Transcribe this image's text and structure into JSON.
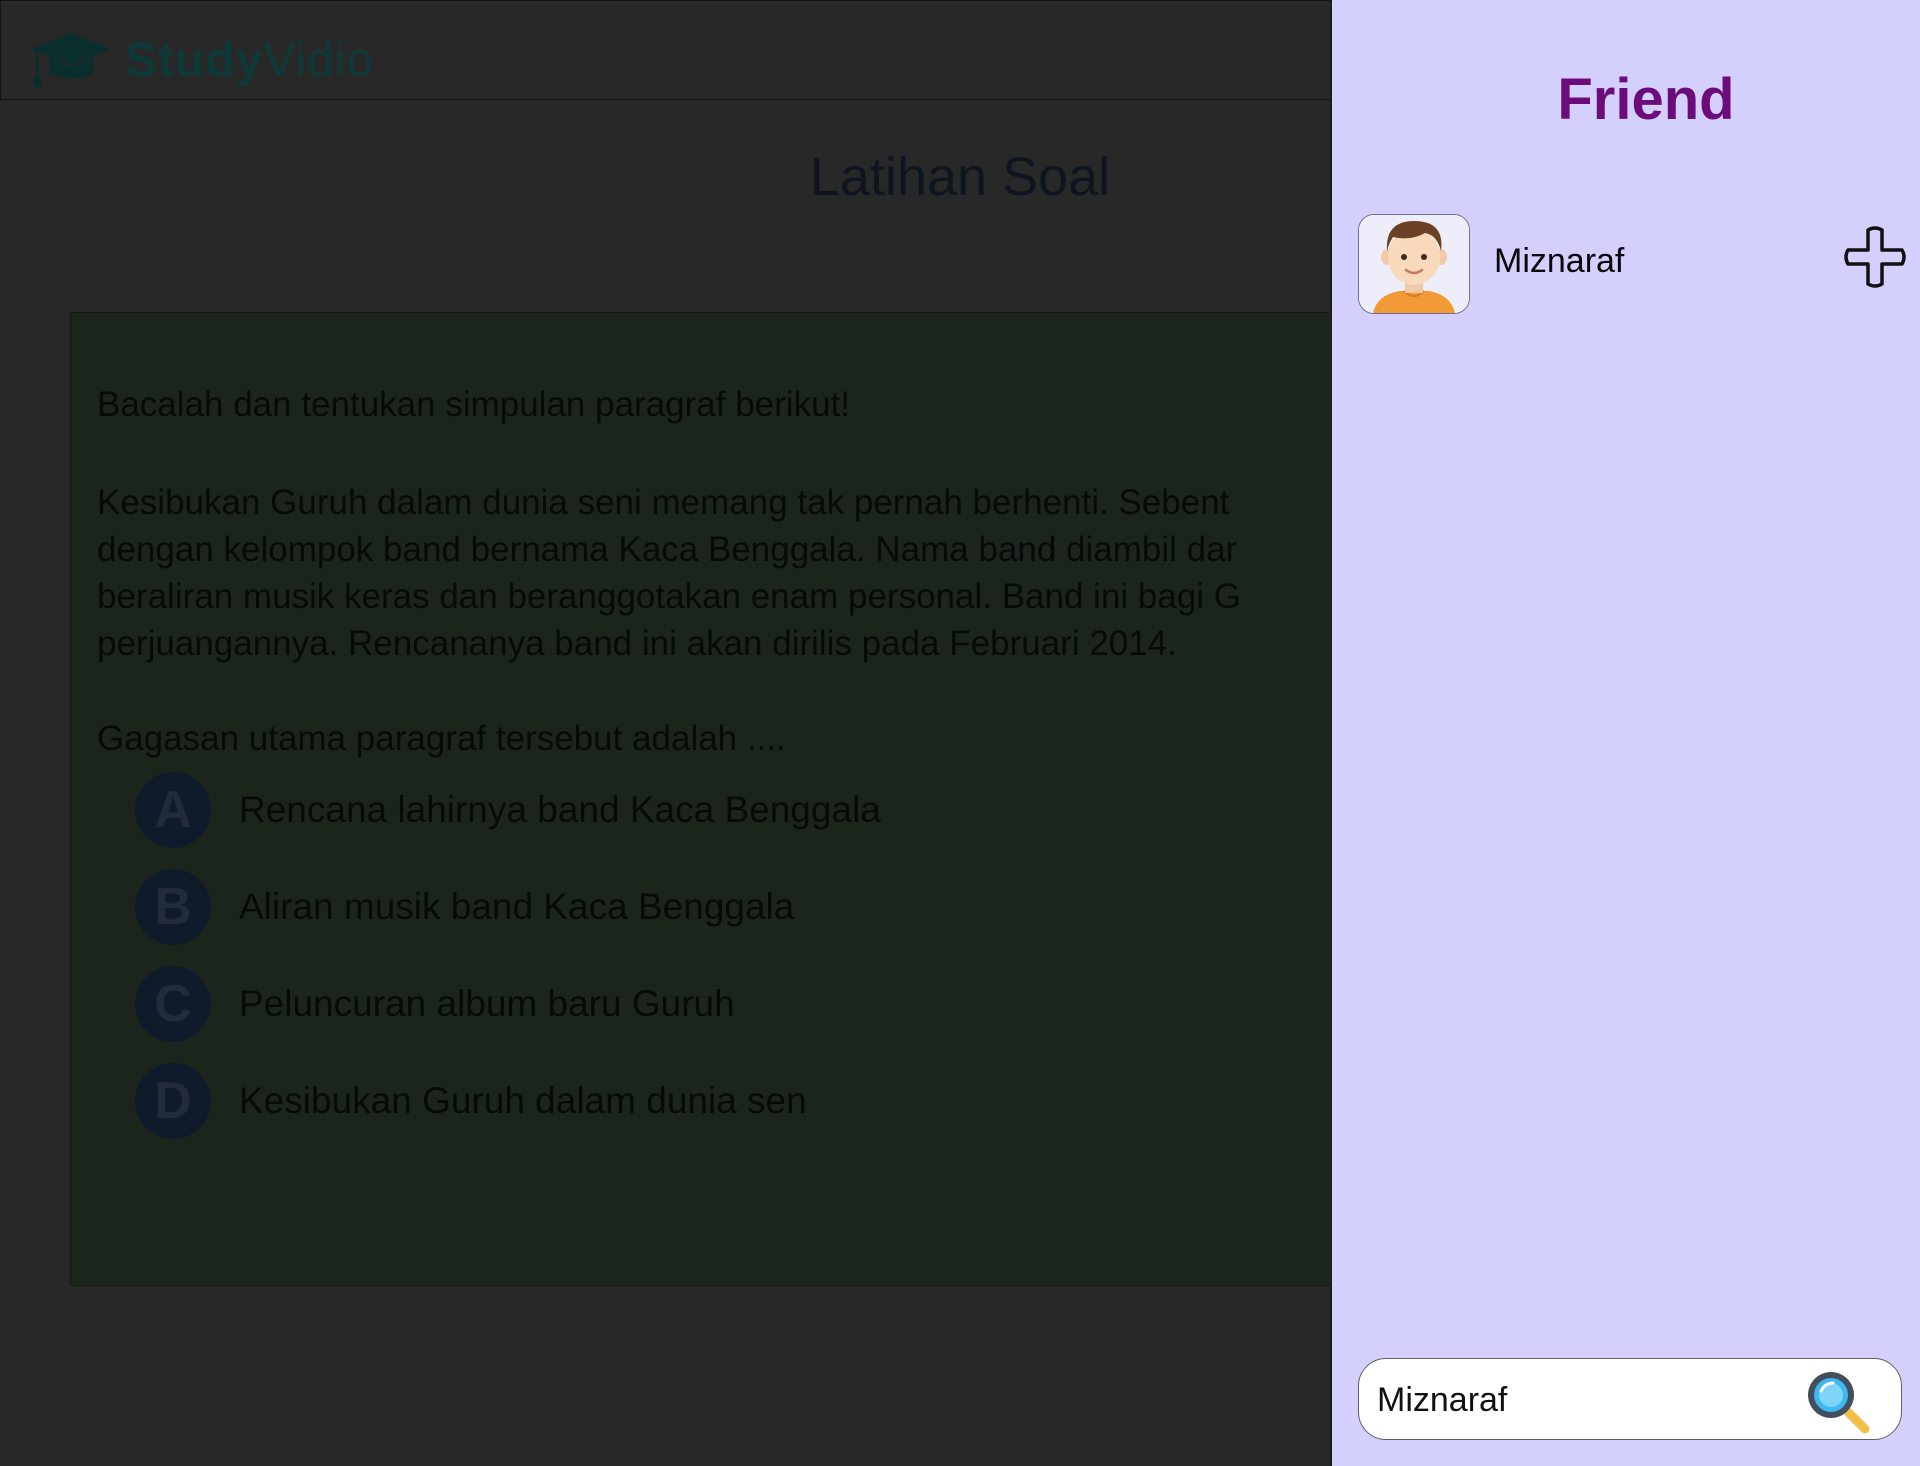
{
  "app": {
    "logo_bold": "Study",
    "logo_light": "Vidio"
  },
  "page": {
    "title": "Latihan Soal"
  },
  "quiz": {
    "instruction": "Bacalah dan tentukan simpulan paragraf berikut!",
    "passage_lines": [
      "Kesibukan Guruh dalam dunia seni memang tak pernah berhenti. Sebent",
      "dengan kelompok band bernama Kaca Benggala. Nama band diambil dar",
      "beraliran musik keras dan beranggotakan enam personal. Band ini bagi G",
      "perjuangannya. Rencananya band ini akan dirilis pada Februari 2014."
    ],
    "question": "Gagasan utama paragraf tersebut adalah ....",
    "options": [
      {
        "letter": "A",
        "text": "Rencana lahirnya band Kaca Benggala"
      },
      {
        "letter": "B",
        "text": "Aliran musik band Kaca Benggala"
      },
      {
        "letter": "C",
        "text": "Peluncuran album baru Guruh"
      },
      {
        "letter": "D",
        "text": "Kesibukan Guruh dalam dunia sen"
      }
    ]
  },
  "friend_panel": {
    "title": "Friend",
    "results": [
      {
        "name": "Miznaraf",
        "avatar": "boy-avatar",
        "action_icon": "plus-icon"
      }
    ],
    "search": {
      "value": "Miznaraf",
      "icon": "magnifier-icon"
    }
  },
  "colors": {
    "panel_bg": "#d4d0fd",
    "title_purple": "#6c0b7a",
    "overlay_dim": "#282828"
  }
}
